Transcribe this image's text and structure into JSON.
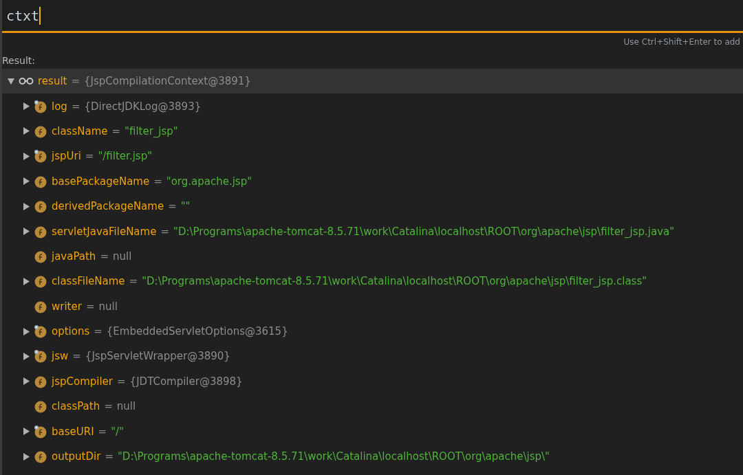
{
  "expression": {
    "value": "ctxt"
  },
  "hint": "Use Ctrl+Shift+Enter to add",
  "result_label": "Result:",
  "tree": [
    {
      "name": "result",
      "separator": "=",
      "value": "{JspCompilationContext@3891}",
      "kind": "watch",
      "color": "#8d8d8d",
      "expandable": true,
      "selected": true,
      "children": [
        {
          "name": "log",
          "separator": "=",
          "value": "{DirectJDKLog@3893}",
          "kind": "field",
          "color": "#8d8d8d",
          "expandable": true,
          "selected": false,
          "final": true
        },
        {
          "name": "className",
          "separator": "=",
          "value": "\"filter_jsp\"",
          "kind": "field",
          "color": "#4fb33a",
          "expandable": true,
          "selected": false,
          "final": false
        },
        {
          "name": "jspUri",
          "separator": "=",
          "value": "\"/filter.jsp\"",
          "kind": "field",
          "color": "#4fb33a",
          "expandable": true,
          "selected": false,
          "final": true
        },
        {
          "name": "basePackageName",
          "separator": "=",
          "value": "\"org.apache.jsp\"",
          "kind": "field",
          "color": "#4fb33a",
          "expandable": true,
          "selected": false,
          "final": false
        },
        {
          "name": "derivedPackageName",
          "separator": "=",
          "value": "\"\"",
          "kind": "field",
          "color": "#4fb33a",
          "expandable": true,
          "selected": false,
          "final": false
        },
        {
          "name": "servletJavaFileName",
          "separator": "=",
          "value": "\"D:\\Programs\\apache-tomcat-8.5.71\\work\\Catalina\\localhost\\ROOT\\org\\apache\\jsp\\filter_jsp.java\"",
          "kind": "field",
          "color": "#4fb33a",
          "expandable": true,
          "selected": false,
          "final": false
        },
        {
          "name": "javaPath",
          "separator": "=",
          "value": "null",
          "kind": "field",
          "color": "#8d8d8d",
          "expandable": false,
          "selected": false,
          "final": false
        },
        {
          "name": "classFileName",
          "separator": "=",
          "value": "\"D:\\Programs\\apache-tomcat-8.5.71\\work\\Catalina\\localhost\\ROOT\\org\\apache\\jsp\\filter_jsp.class\"",
          "kind": "field",
          "color": "#4fb33a",
          "expandable": true,
          "selected": false,
          "final": false
        },
        {
          "name": "writer",
          "separator": "=",
          "value": "null",
          "kind": "field",
          "color": "#8d8d8d",
          "expandable": false,
          "selected": false,
          "final": false
        },
        {
          "name": "options",
          "separator": "=",
          "value": "{EmbeddedServletOptions@3615}",
          "kind": "field",
          "color": "#8d8d8d",
          "expandable": true,
          "selected": false,
          "final": true
        },
        {
          "name": "jsw",
          "separator": "=",
          "value": "{JspServletWrapper@3890}",
          "kind": "field",
          "color": "#8d8d8d",
          "expandable": true,
          "selected": false,
          "final": true
        },
        {
          "name": "jspCompiler",
          "separator": "=",
          "value": "{JDTCompiler@3898}",
          "kind": "field",
          "color": "#8d8d8d",
          "expandable": true,
          "selected": false,
          "final": false
        },
        {
          "name": "classPath",
          "separator": "=",
          "value": "null",
          "kind": "field",
          "color": "#8d8d8d",
          "expandable": false,
          "selected": false,
          "final": false
        },
        {
          "name": "baseURI",
          "separator": "=",
          "value": "\"/\"",
          "kind": "field",
          "color": "#4fb33a",
          "expandable": true,
          "selected": false,
          "final": true
        },
        {
          "name": "outputDir",
          "separator": "=",
          "value": "\"D:\\Programs\\apache-tomcat-8.5.71\\work\\Catalina\\localhost\\ROOT\\org\\apache\\jsp\\\"",
          "kind": "field",
          "color": "#4fb33a",
          "expandable": true,
          "selected": false,
          "final": false
        }
      ]
    }
  ]
}
